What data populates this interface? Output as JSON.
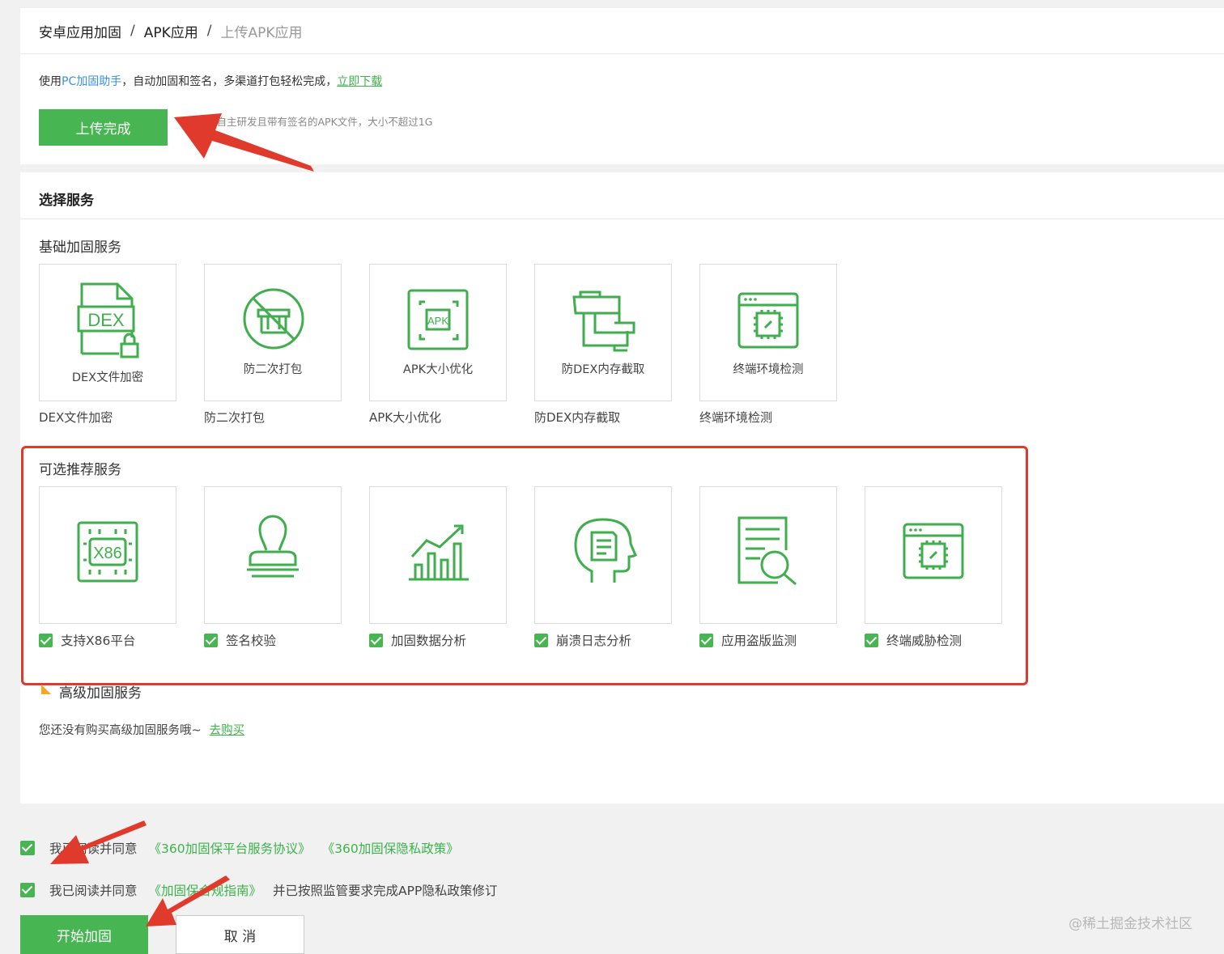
{
  "breadcrumb": {
    "level1": "安卓应用加固",
    "level2": "APK应用",
    "current": "上传APK应用",
    "separator": "/"
  },
  "helper_tip": {
    "prefix": "使用",
    "pc_helper": "PC加固助手",
    "middle": "，自动加固和签名，多渠道打包轻松完成，",
    "download_link": "立即下载"
  },
  "upload": {
    "button_label": "上传完成",
    "tip": "请提交自主研发且带有签名的APK文件，大小不超过1G"
  },
  "service": {
    "section_title": "选择服务",
    "basic_title": "基础加固服务",
    "basic_items": [
      {
        "icon": "dex-file-lock-icon",
        "caption": "DEX文件加密",
        "label": "DEX文件加密"
      },
      {
        "icon": "no-repack-icon",
        "caption": "防二次打包",
        "label": "防二次打包"
      },
      {
        "icon": "apk-chip-icon",
        "caption": "APK大小优化",
        "label": "APK大小优化"
      },
      {
        "icon": "memory-intercept-icon",
        "caption": "防DEX内存截取",
        "label": "防DEX内存截取"
      },
      {
        "icon": "terminal-env-icon",
        "caption": "终端环境检测",
        "label": "终端环境检测"
      }
    ],
    "optional_title": "可选推荐服务",
    "optional_items": [
      {
        "icon": "x86-chip-icon",
        "label": "支持X86平台",
        "chip_text": "X86",
        "checked": true
      },
      {
        "icon": "stamp-icon",
        "label": "签名校验",
        "checked": true
      },
      {
        "icon": "growth-chart-icon",
        "label": "加固数据分析",
        "checked": true
      },
      {
        "icon": "head-document-icon",
        "label": "崩溃日志分析",
        "checked": true
      },
      {
        "icon": "document-search-icon",
        "label": "应用盗版监测",
        "checked": true
      },
      {
        "icon": "browser-chip-icon",
        "label": "终端威胁检测",
        "checked": true
      }
    ],
    "advanced_title": "高级加固服务",
    "advanced_tip": "您还没有购买高级加固服务哦~",
    "buy_link": "去购买"
  },
  "agreements": {
    "row1": {
      "prefix": "我已阅读并同意",
      "link1": "《360加固保平台服务协议》",
      "link2": "《360加固保隐私政策》",
      "checked": true
    },
    "row2": {
      "prefix": "我已阅读并同意",
      "link1": "《加固保合规指南》",
      "suffix": "并已按照监管要求完成APP隐私政策修订",
      "checked": true
    }
  },
  "actions": {
    "start_label": "开始加固",
    "cancel_label": "取 消"
  },
  "watermark": "@稀土掘金技术社区",
  "colors": {
    "primary_green": "#47b552",
    "link_blue": "#3b8fe0",
    "annotation_red": "#e03a2c",
    "flag_orange": "#f5a623"
  }
}
